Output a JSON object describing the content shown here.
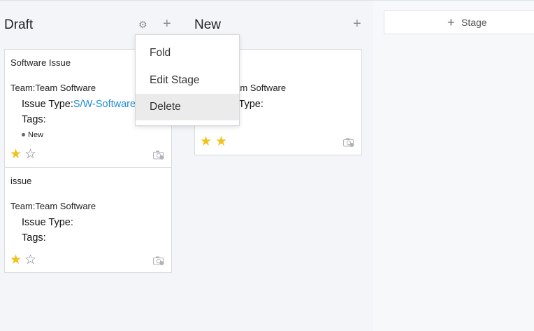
{
  "columns": [
    {
      "title": "Draft",
      "cards": [
        {
          "name": "Software Issue",
          "team": "Team:Team Software",
          "issue_type_label": "Issue Type:",
          "issue_type_value": "S/W-Software",
          "tags_label": "Tags:",
          "tag": "New",
          "stars": [
            true,
            false
          ]
        },
        {
          "name": "issue",
          "team": "Team:Team Software",
          "issue_type_label": "Issue Type:",
          "issue_type_value": "",
          "tags_label": "Tags:",
          "stars": [
            true,
            false
          ]
        }
      ]
    },
    {
      "title": "New",
      "cards": [
        {
          "name": "...",
          "team": "Team:Team Software",
          "issue_type_label": "Issue Type:",
          "stars": [
            true,
            true
          ]
        }
      ]
    }
  ],
  "stage_menu": {
    "items": [
      "Fold",
      "Edit Stage",
      "Delete"
    ],
    "highlighted": "Delete"
  },
  "add_stage": {
    "label": "Stage",
    "icon": "plus-icon"
  },
  "icons": {
    "settings": "gear-icon",
    "add": "plus-icon",
    "star_filled": "star-filled-icon",
    "star_empty": "star-empty-icon",
    "attachment": "camera-icon"
  },
  "colors": {
    "star": "#f1c21b",
    "link": "#1f8ed6",
    "highlight": "#ebebeb"
  }
}
